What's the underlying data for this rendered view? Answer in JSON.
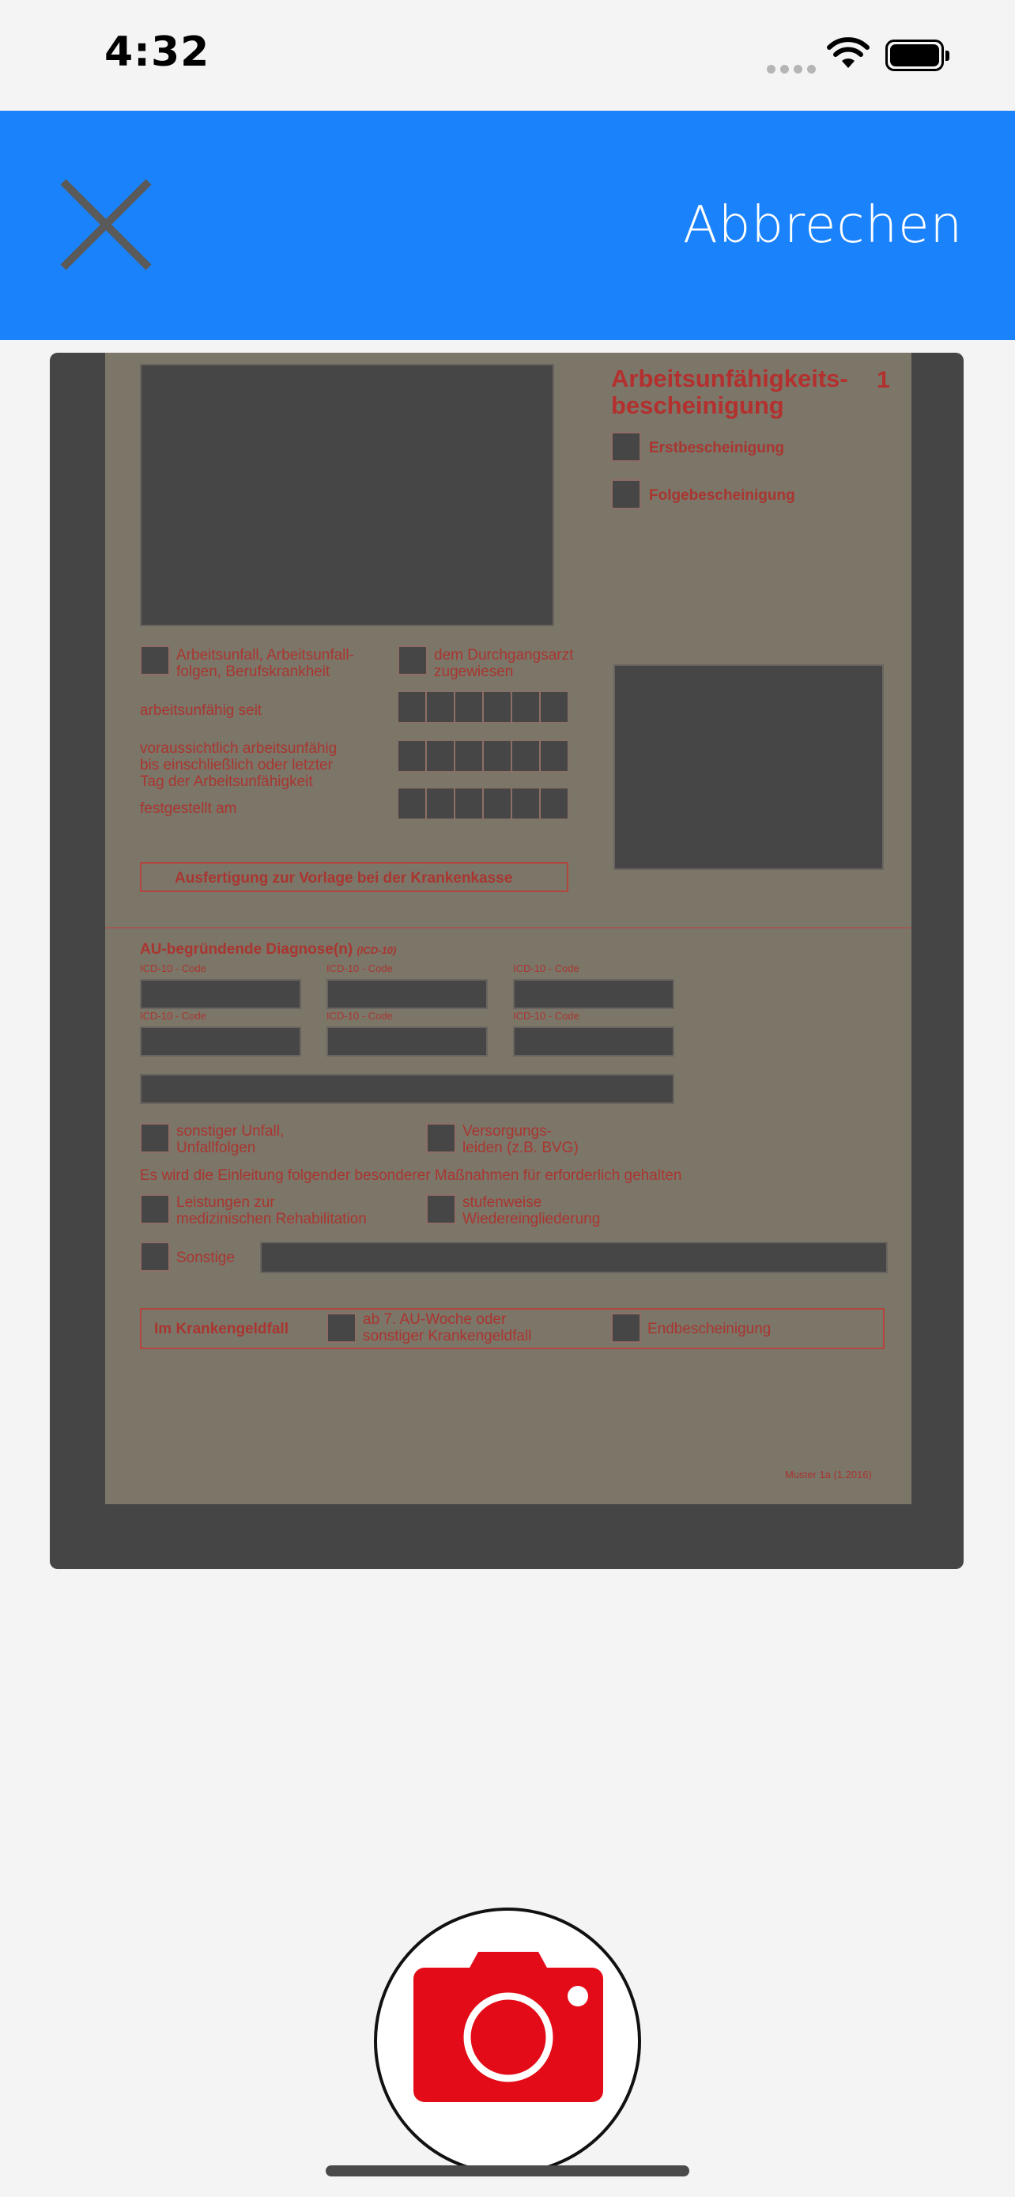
{
  "status_bar": {
    "time": "4:32"
  },
  "header": {
    "cancel_label": "Abbrechen"
  },
  "document": {
    "title_line1": "Arbeitsunfähigkeits-",
    "title_line2": "bescheinigung",
    "number": "1",
    "option_erst": "Erstbescheinigung",
    "option_folge": "Folgebescheinigung",
    "option_unfall_l1": "Arbeitsunfall, Arbeitsunfall-",
    "option_unfall_l2": "folgen, Berufskrankheit",
    "option_durchgang_l1": "dem Durchgangsarzt",
    "option_durchgang_l2": "zugewiesen",
    "label_seit": "arbeitsunfähig seit",
    "label_voraus_l1": "voraussichtlich arbeitsunfähig",
    "label_voraus_l2": "bis einschließlich oder letzter",
    "label_voraus_l3": "Tag der Arbeitsunfähigkeit",
    "label_festgestellt": "festgestellt am",
    "krankenkasse_label": "Ausfertigung zur Vorlage bei der Krankenkasse",
    "diagnose_label": "AU-begründende Diagnose(n)",
    "diagnose_suffix": "(ICD-10)",
    "icd_label": "ICD-10 - Code",
    "option_sonstiger_l1": "sonstiger Unfall,",
    "option_sonstiger_l2": "Unfallfolgen",
    "option_versorgung_l1": "Versorgungs-",
    "option_versorgung_l2": "leiden (z.B. BVG)",
    "massnahmen_label": "Es wird die Einleitung folgender besonderer Maßnahmen für erforderlich gehalten",
    "option_leistungen_l1": "Leistungen zur",
    "option_leistungen_l2": "medizinischen Rehabilitation",
    "option_stufen_l1": "stufenweise",
    "option_stufen_l2": "Wiedereingliederung",
    "option_sonstige": "Sonstige",
    "krankengeld_label": "Im Krankengeldfall",
    "option_au_woche_l1": "ab 7. AU-Woche oder",
    "option_au_woche_l2": "sonstiger Krankengeldfall",
    "option_end": "Endbescheinigung",
    "footer_code": "Muster 1a (1.2016)"
  },
  "colors": {
    "header_bg": "#1a82fb",
    "shutter_accent": "#e30b17",
    "background": "#f4f4f4"
  },
  "icons": {
    "close": "close-icon",
    "wifi": "wifi-icon",
    "battery": "battery-icon",
    "camera": "camera-icon"
  }
}
